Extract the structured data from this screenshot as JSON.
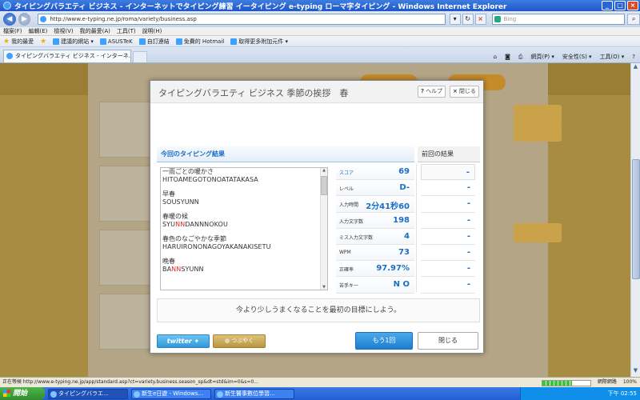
{
  "window": {
    "title": "タイピングバラエティ ビジネス - インターネットでタイピング練習 イータイピング e-typing ローマ字タイピング - Windows Internet Explorer"
  },
  "address": {
    "url": "http://www.e-typing.ne.jp/roma/variety/business.asp",
    "search_placeholder": "Bing"
  },
  "menu": [
    "檔案(F)",
    "編輯(E)",
    "檢視(V)",
    "我的最愛(A)",
    "工具(T)",
    "說明(H)"
  ],
  "favorites": {
    "label": "我的最愛",
    "items": [
      "建議的網站 ▾",
      "ASUSTeK",
      "自訂連結",
      "免費的 Hotmail",
      "取得更多附加元件 ▾"
    ]
  },
  "tab": {
    "label": "タイピングバラエティ ビジネス - インターネ..."
  },
  "commands": [
    "網頁(P) ▾",
    "安全性(S) ▾",
    "工具(O) ▾",
    "?"
  ],
  "modal": {
    "title": "タイピングバラエティ ビジネス 季節の挨拶　春",
    "help_label": "ヘルプ",
    "close_label": "閉じる",
    "results_header": "今回のタイピング結果",
    "previous_header": "前回の結果",
    "words": [
      {
        "jp": "一雨ごとの暖かさ",
        "ro": [
          {
            "t": "HITOAMEGOTONOATATAKASA",
            "m": false
          }
        ]
      },
      {
        "jp": "早春",
        "ro": [
          {
            "t": "SOUSYUNN",
            "m": false
          }
        ]
      },
      {
        "jp": "春暖の候",
        "ro": [
          {
            "t": "SYU",
            "m": false
          },
          {
            "t": "NN",
            "m": true
          },
          {
            "t": "DANNNOKOU",
            "m": false
          }
        ]
      },
      {
        "jp": "春色のなごやかな季節",
        "ro": [
          {
            "t": "HARUIRONONAGOYAKANAKISETU",
            "m": false
          }
        ]
      },
      {
        "jp": "晩春",
        "ro": [
          {
            "t": "BA",
            "m": false
          },
          {
            "t": "NN",
            "m": true
          },
          {
            "t": "SYUNN",
            "m": false
          }
        ]
      }
    ],
    "stats": [
      {
        "label": "スコア",
        "value": "69",
        "prev": "-"
      },
      {
        "label": "レベル",
        "value": "D-",
        "prev": "-"
      },
      {
        "label": "入力時間",
        "value": "2分41秒60",
        "prev": "-"
      },
      {
        "label": "入力文字数",
        "value": "198",
        "prev": "-"
      },
      {
        "label": "ミス入力文字数",
        "value": "4",
        "prev": "-"
      },
      {
        "label": "WPM",
        "value": "73",
        "prev": "-"
      },
      {
        "label": "正確率",
        "value": "97.97%",
        "prev": "-"
      },
      {
        "label": "苦手キー",
        "value": "N O",
        "prev": "-"
      }
    ],
    "message": "今より少しうまくなることを最初の目標にしよう。",
    "twitter_label": "twitter",
    "tsubuyaku_label": "つぶやく",
    "retry_label": "もう1回",
    "close_button": "閉じる"
  },
  "statusbar": {
    "text": "正在等候 http://www.e-typing.ne.jp/app/standard.asp?ct=variety.business.season_sp&dt=std&im=0&s=0...",
    "zone": "網際網路",
    "zoom": "100%",
    "progress": 0.62
  },
  "taskbar": {
    "start": "開始",
    "tasks": [
      "タイピングバラエ...",
      "新生e日遊 - Windows...",
      "新生醫事數位學習..."
    ],
    "clock": "下午 02:55"
  },
  "colors": {
    "accent": "#1a6ec4",
    "miss": "#e02828",
    "retry": "#1c7fcf"
  }
}
